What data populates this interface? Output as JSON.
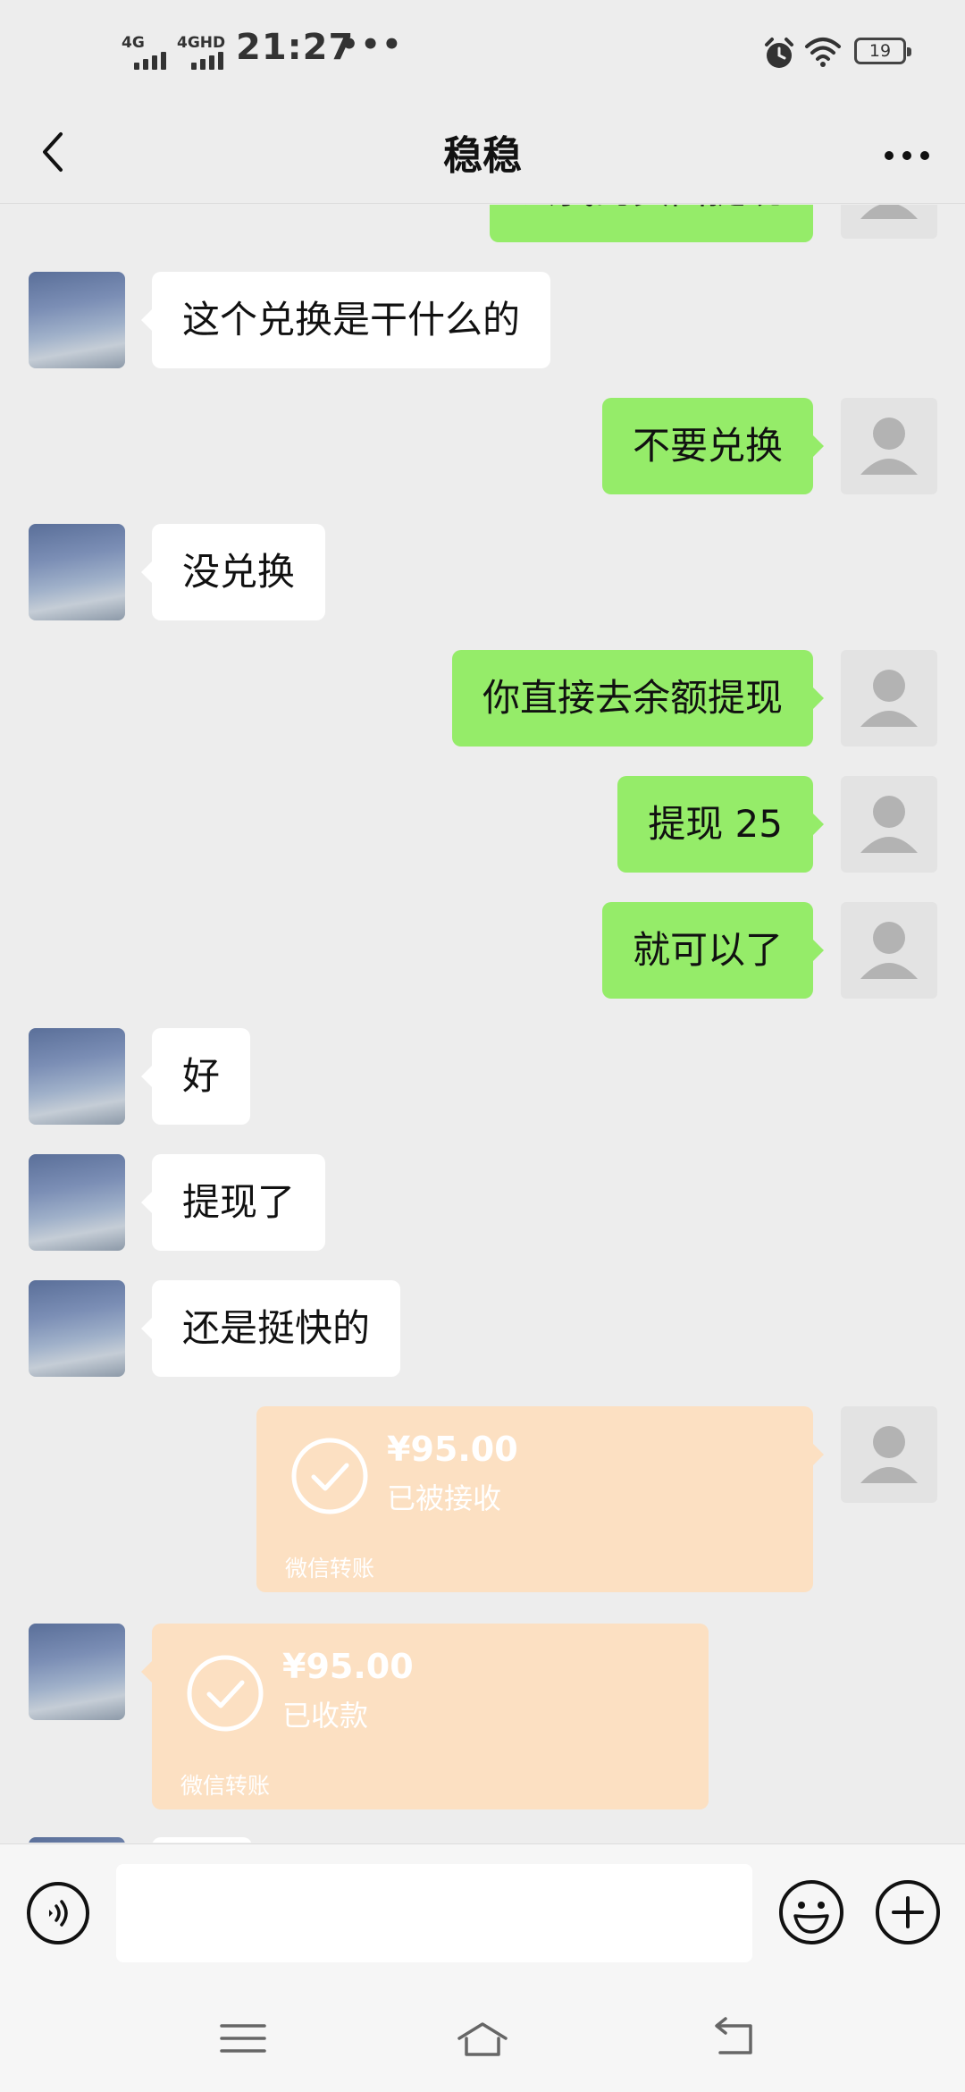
{
  "status_bar": {
    "net1": "4G",
    "net2": "4GHD",
    "time": "21:27",
    "overflow": "•••",
    "battery": "19",
    "icons": [
      "alarm-icon",
      "wifi-icon",
      "battery-icon"
    ]
  },
  "header": {
    "title": "稳稳",
    "back_icon": "back-chevron-icon",
    "more_icon": "more-dots-icon"
  },
  "messages": [
    {
      "side": "out",
      "text": "去我的页面提现"
    },
    {
      "side": "in",
      "text": "这个兑换是干什么的"
    },
    {
      "side": "out",
      "text": "不要兑换"
    },
    {
      "side": "in",
      "text": "没兑换"
    },
    {
      "side": "out",
      "text": "你直接去余额提现"
    },
    {
      "side": "out",
      "text": "提现 25"
    },
    {
      "side": "out",
      "text": "就可以了"
    },
    {
      "side": "in",
      "text": "好"
    },
    {
      "side": "in",
      "text": "提现了"
    },
    {
      "side": "in",
      "text": "还是挺快的"
    }
  ],
  "transfers": [
    {
      "side": "out",
      "amount": "¥95.00",
      "status": "已被接收",
      "label": "微信转账"
    },
    {
      "side": "in",
      "amount": "¥95.00",
      "status": "已收款",
      "label": "微信转账"
    }
  ],
  "input_bar": {
    "placeholder": "",
    "voice_icon": "voice-icon",
    "emoji_icon": "emoji-icon",
    "plus_icon": "plus-icon"
  },
  "nav_bar": {
    "icons": [
      "menu-icon",
      "home-icon",
      "back-icon"
    ]
  },
  "colors": {
    "background": "#ededed",
    "bubble_out": "#95ec69",
    "bubble_in": "#ffffff",
    "transfer": "#fce0c2"
  }
}
